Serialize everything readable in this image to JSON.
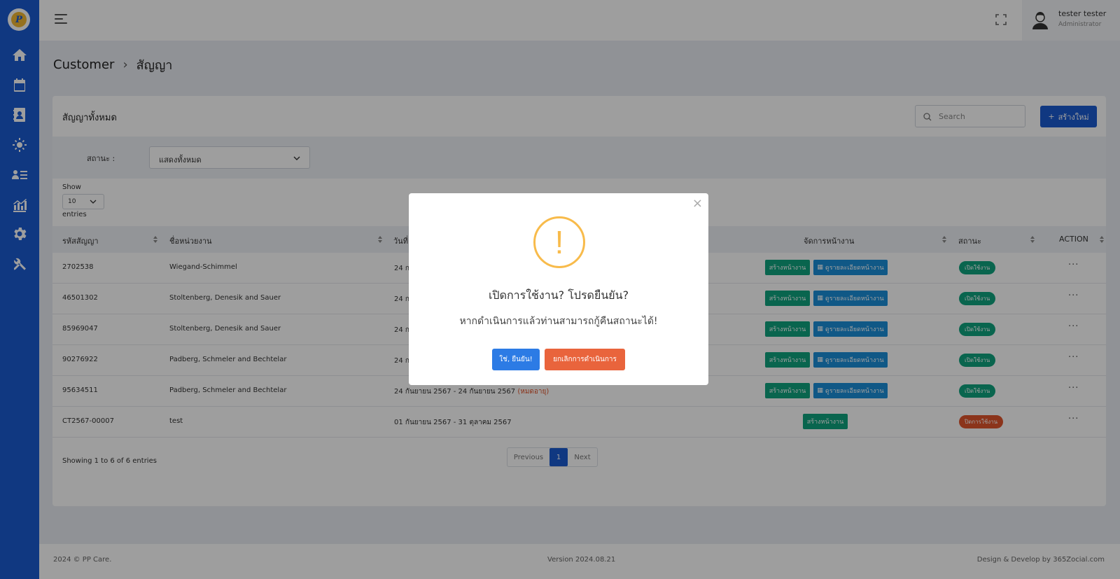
{
  "header": {
    "user_name": "tester tester",
    "user_role": "Administrator"
  },
  "breadcrumb": {
    "parent": "Customer",
    "separator": "›",
    "current": "สัญญา"
  },
  "card": {
    "title": "สัญญาทั้งหมด",
    "search_placeholder": "Search",
    "create_label": "สร้างใหม่",
    "filter_label": "สถานะ :",
    "filter_value": "แสดงทั้งหมด",
    "show_label": "Show",
    "page_length": "10",
    "entries_label": "entries"
  },
  "table": {
    "columns": [
      "รหัสสัญญา",
      "ชื่อหน่วยงาน",
      "วันที่",
      "จัดการหน้างาน",
      "สถานะ",
      "ACTION"
    ],
    "btn_create_site": "สร้างหน้างาน",
    "btn_view_site": "ดูรายละเอียดหน้างาน",
    "rows": [
      {
        "code": "2702538",
        "agency": "Wiegand-Schimmel",
        "date": "24 ก",
        "expired": "",
        "status": "เปิดใช้งาน"
      },
      {
        "code": "46501302",
        "agency": "Stoltenberg, Denesik and Sauer",
        "date": "24 ก",
        "expired": "",
        "status": "เปิดใช้งาน"
      },
      {
        "code": "85969047",
        "agency": "Stoltenberg, Denesik and Sauer",
        "date": "24 ก",
        "expired": "",
        "status": "เปิดใช้งาน"
      },
      {
        "code": "90276922",
        "agency": "Padberg, Schmeler and Bechtelar",
        "date": "24 ก",
        "expired": "",
        "status": "เปิดใช้งาน"
      },
      {
        "code": "95634511",
        "agency": "Padberg, Schmeler and Bechtelar",
        "date": "24 กันยายน 2567 - 24 กันยายน 2567",
        "expired": "(หมดอายุ)",
        "status": "เปิดใช้งาน"
      },
      {
        "code": "CT2567-00007",
        "agency": "test",
        "date": "01 กันยายน 2567 - 31 ตุลาคม 2567",
        "expired": "",
        "status": "ปิดการใช้งาน"
      }
    ],
    "action_dots": "···"
  },
  "pagination": {
    "info": "Showing 1 to 6 of 6 entries",
    "prev": "Previous",
    "page": "1",
    "next": "Next"
  },
  "footer": {
    "copyright": "2024 © PP Care.",
    "version": "Version 2024.08.21",
    "credit": "Design & Develop by 365Zocial.com"
  },
  "modal": {
    "close": "×",
    "icon": "!",
    "title": "เปิดการใช้งาน? โปรดยืนยัน?",
    "text": "หากดำเนินการแล้วท่านสามารถกู้คืนสถานะได้!",
    "confirm": "ใช่, ยืนยัน!",
    "cancel": "ยกเลิกการดำเนินการ"
  },
  "colors": {
    "sidebar": "#1b5bd1",
    "primary": "#1b5bd1",
    "success": "#10a37f",
    "info": "#1a8fd8",
    "danger": "#e0542c",
    "warning": "#f8bb4b"
  }
}
